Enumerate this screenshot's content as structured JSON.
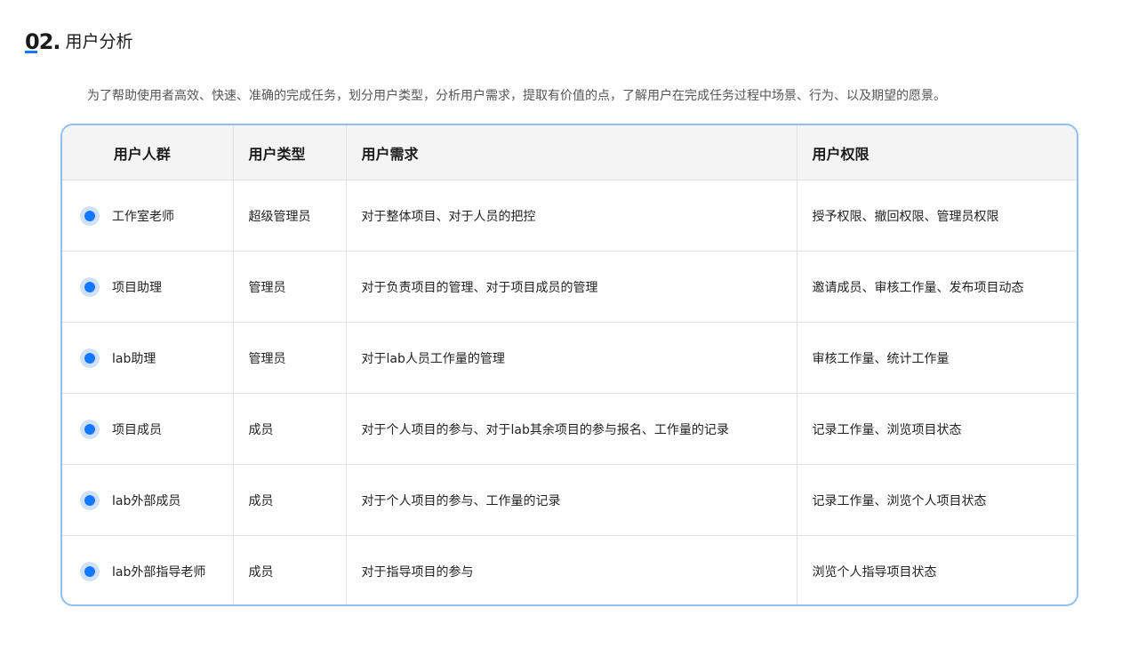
{
  "section": {
    "number": "02.",
    "label": "用户分析"
  },
  "intro": "为了帮助使用者高效、快速、准确的完成任务，划分用户类型，分析用户需求，提取有价值的点，了解用户在完成任务过程中场景、行为、以及期望的愿景。",
  "table": {
    "headers": [
      "用户人群",
      "用户类型",
      "用户需求",
      "用户权限"
    ],
    "rows": [
      {
        "group": "工作室老师",
        "type": "超级管理员",
        "need": "对于整体项目、对于人员的把控",
        "permission": "授予权限、撤回权限、管理员权限"
      },
      {
        "group": "项目助理",
        "type": "管理员",
        "need": "对于负责项目的管理、对于项目成员的管理",
        "permission": "邀请成员、审核工作量、发布项目动态"
      },
      {
        "group": "lab助理",
        "type": "管理员",
        "need": "对于lab人员工作量的管理",
        "permission": "审核工作量、统计工作量"
      },
      {
        "group": "项目成员",
        "type": "成员",
        "need": "对于个人项目的参与、对于lab其余项目的参与报名、工作量的记录",
        "permission": "记录工作量、浏览项目状态"
      },
      {
        "group": "lab外部成员",
        "type": "成员",
        "need": "对于个人项目的参与、工作量的记录",
        "permission": "记录工作量、浏览个人项目状态"
      },
      {
        "group": "lab外部指导老师",
        "type": "成员",
        "need": "对于指导项目的参与",
        "permission": "浏览个人指导项目状态"
      }
    ]
  },
  "colors": {
    "accent": "#1677ff",
    "dot_halo": "#cfe1fb",
    "frame_border": "#8fbff3",
    "header_bg": "#f4f4f4"
  },
  "icons": {
    "row_marker": "bullet-dot-icon"
  }
}
